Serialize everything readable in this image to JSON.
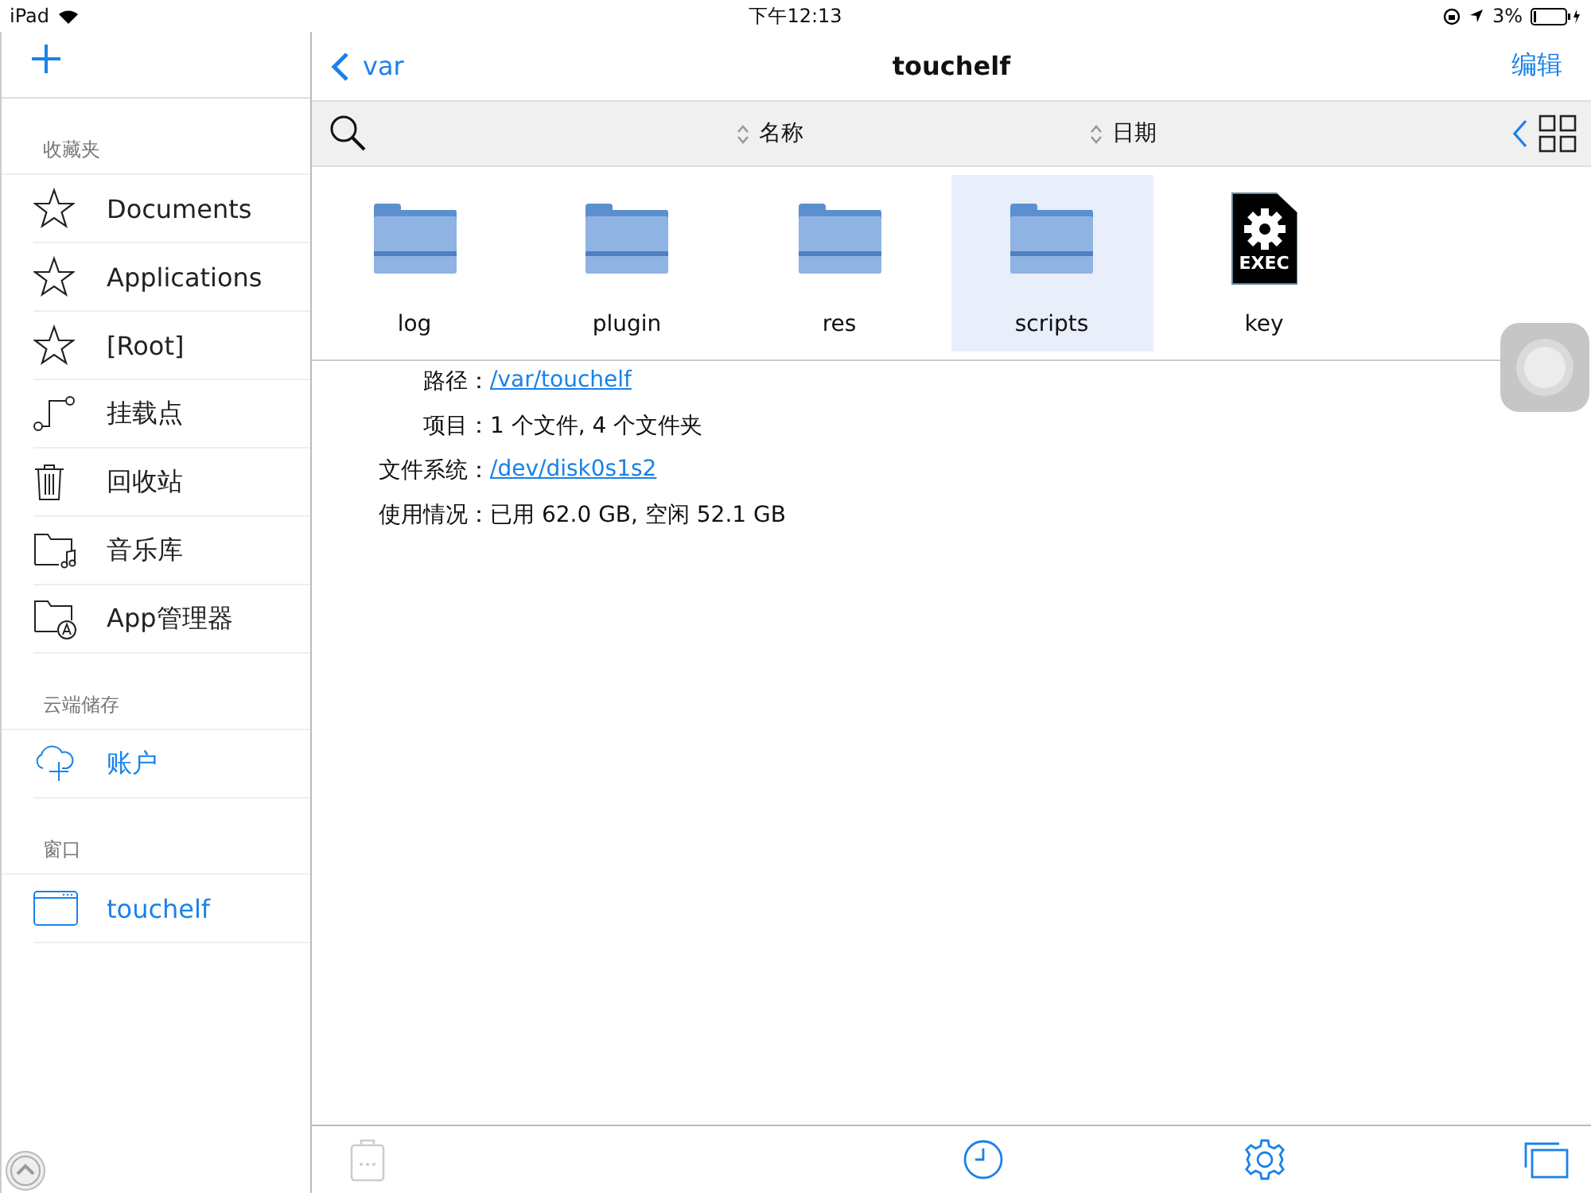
{
  "status_bar": {
    "device": "iPad",
    "time": "下午12:13",
    "battery": "3%"
  },
  "sidebar": {
    "sections": [
      {
        "title": "收藏夹",
        "items": [
          {
            "label": "Documents",
            "kind": "star",
            "accent": false
          },
          {
            "label": "Applications",
            "kind": "star",
            "accent": false
          },
          {
            "label": "[Root]",
            "kind": "star",
            "accent": false
          },
          {
            "label": "挂载点",
            "kind": "mount",
            "accent": false
          },
          {
            "label": "回收站",
            "kind": "trash",
            "accent": false
          },
          {
            "label": "音乐库",
            "kind": "music",
            "accent": false
          },
          {
            "label": "App管理器",
            "kind": "app",
            "accent": false
          }
        ]
      },
      {
        "title": "云端储存",
        "items": [
          {
            "label": "账户",
            "kind": "cloud",
            "accent": true
          }
        ]
      },
      {
        "title": "窗口",
        "items": [
          {
            "label": "touchelf",
            "kind": "window",
            "accent": true
          }
        ]
      }
    ]
  },
  "nav": {
    "back": "var",
    "title": "touchelf",
    "action": "编辑"
  },
  "toolbar": {
    "sort_columns": [
      "名称",
      "日期"
    ]
  },
  "files": [
    {
      "name": "log",
      "kind": "folder",
      "selected": false
    },
    {
      "name": "plugin",
      "kind": "folder",
      "selected": false
    },
    {
      "name": "res",
      "kind": "folder",
      "selected": false
    },
    {
      "name": "scripts",
      "kind": "folder",
      "selected": true
    },
    {
      "name": "key",
      "kind": "exec",
      "badge": "EXEC",
      "selected": false
    }
  ],
  "info": [
    {
      "label": "路径：",
      "value": "/var/touchelf",
      "link": true
    },
    {
      "label": "项目：",
      "value": "1 个文件, 4 个文件夹",
      "link": false
    },
    {
      "label": "文件系统：",
      "value": "/dev/disk0s1s2",
      "link": true
    },
    {
      "label": "使用情况：",
      "value": "已用 62.0 GB, 空闲 52.1 GB",
      "link": false
    }
  ]
}
